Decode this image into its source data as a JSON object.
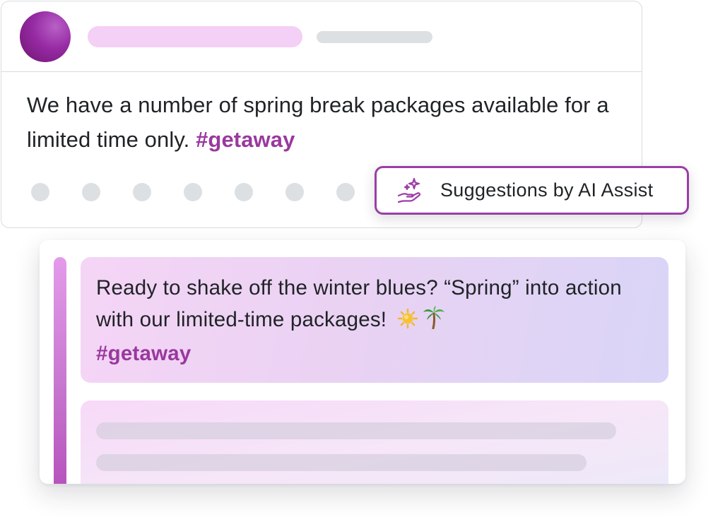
{
  "post": {
    "body": "We have a number of spring break packages available for a limited time only.",
    "hashtag": "#getaway"
  },
  "ai_assist": {
    "label": "Suggestions by AI Assist",
    "icon": "sparkle-hand-icon"
  },
  "suggestions": [
    {
      "text": "Ready to shake off the winter blues? “Spring” into action with our limited-time packages!",
      "emoji": [
        "sun",
        "palm-tree"
      ],
      "hashtag": "#getaway"
    }
  ],
  "colors": {
    "accent": "#99399e",
    "placeholder_gray": "#dde0e3",
    "placeholder_pink": "#f4cff6",
    "border": "#d9dcdf"
  }
}
